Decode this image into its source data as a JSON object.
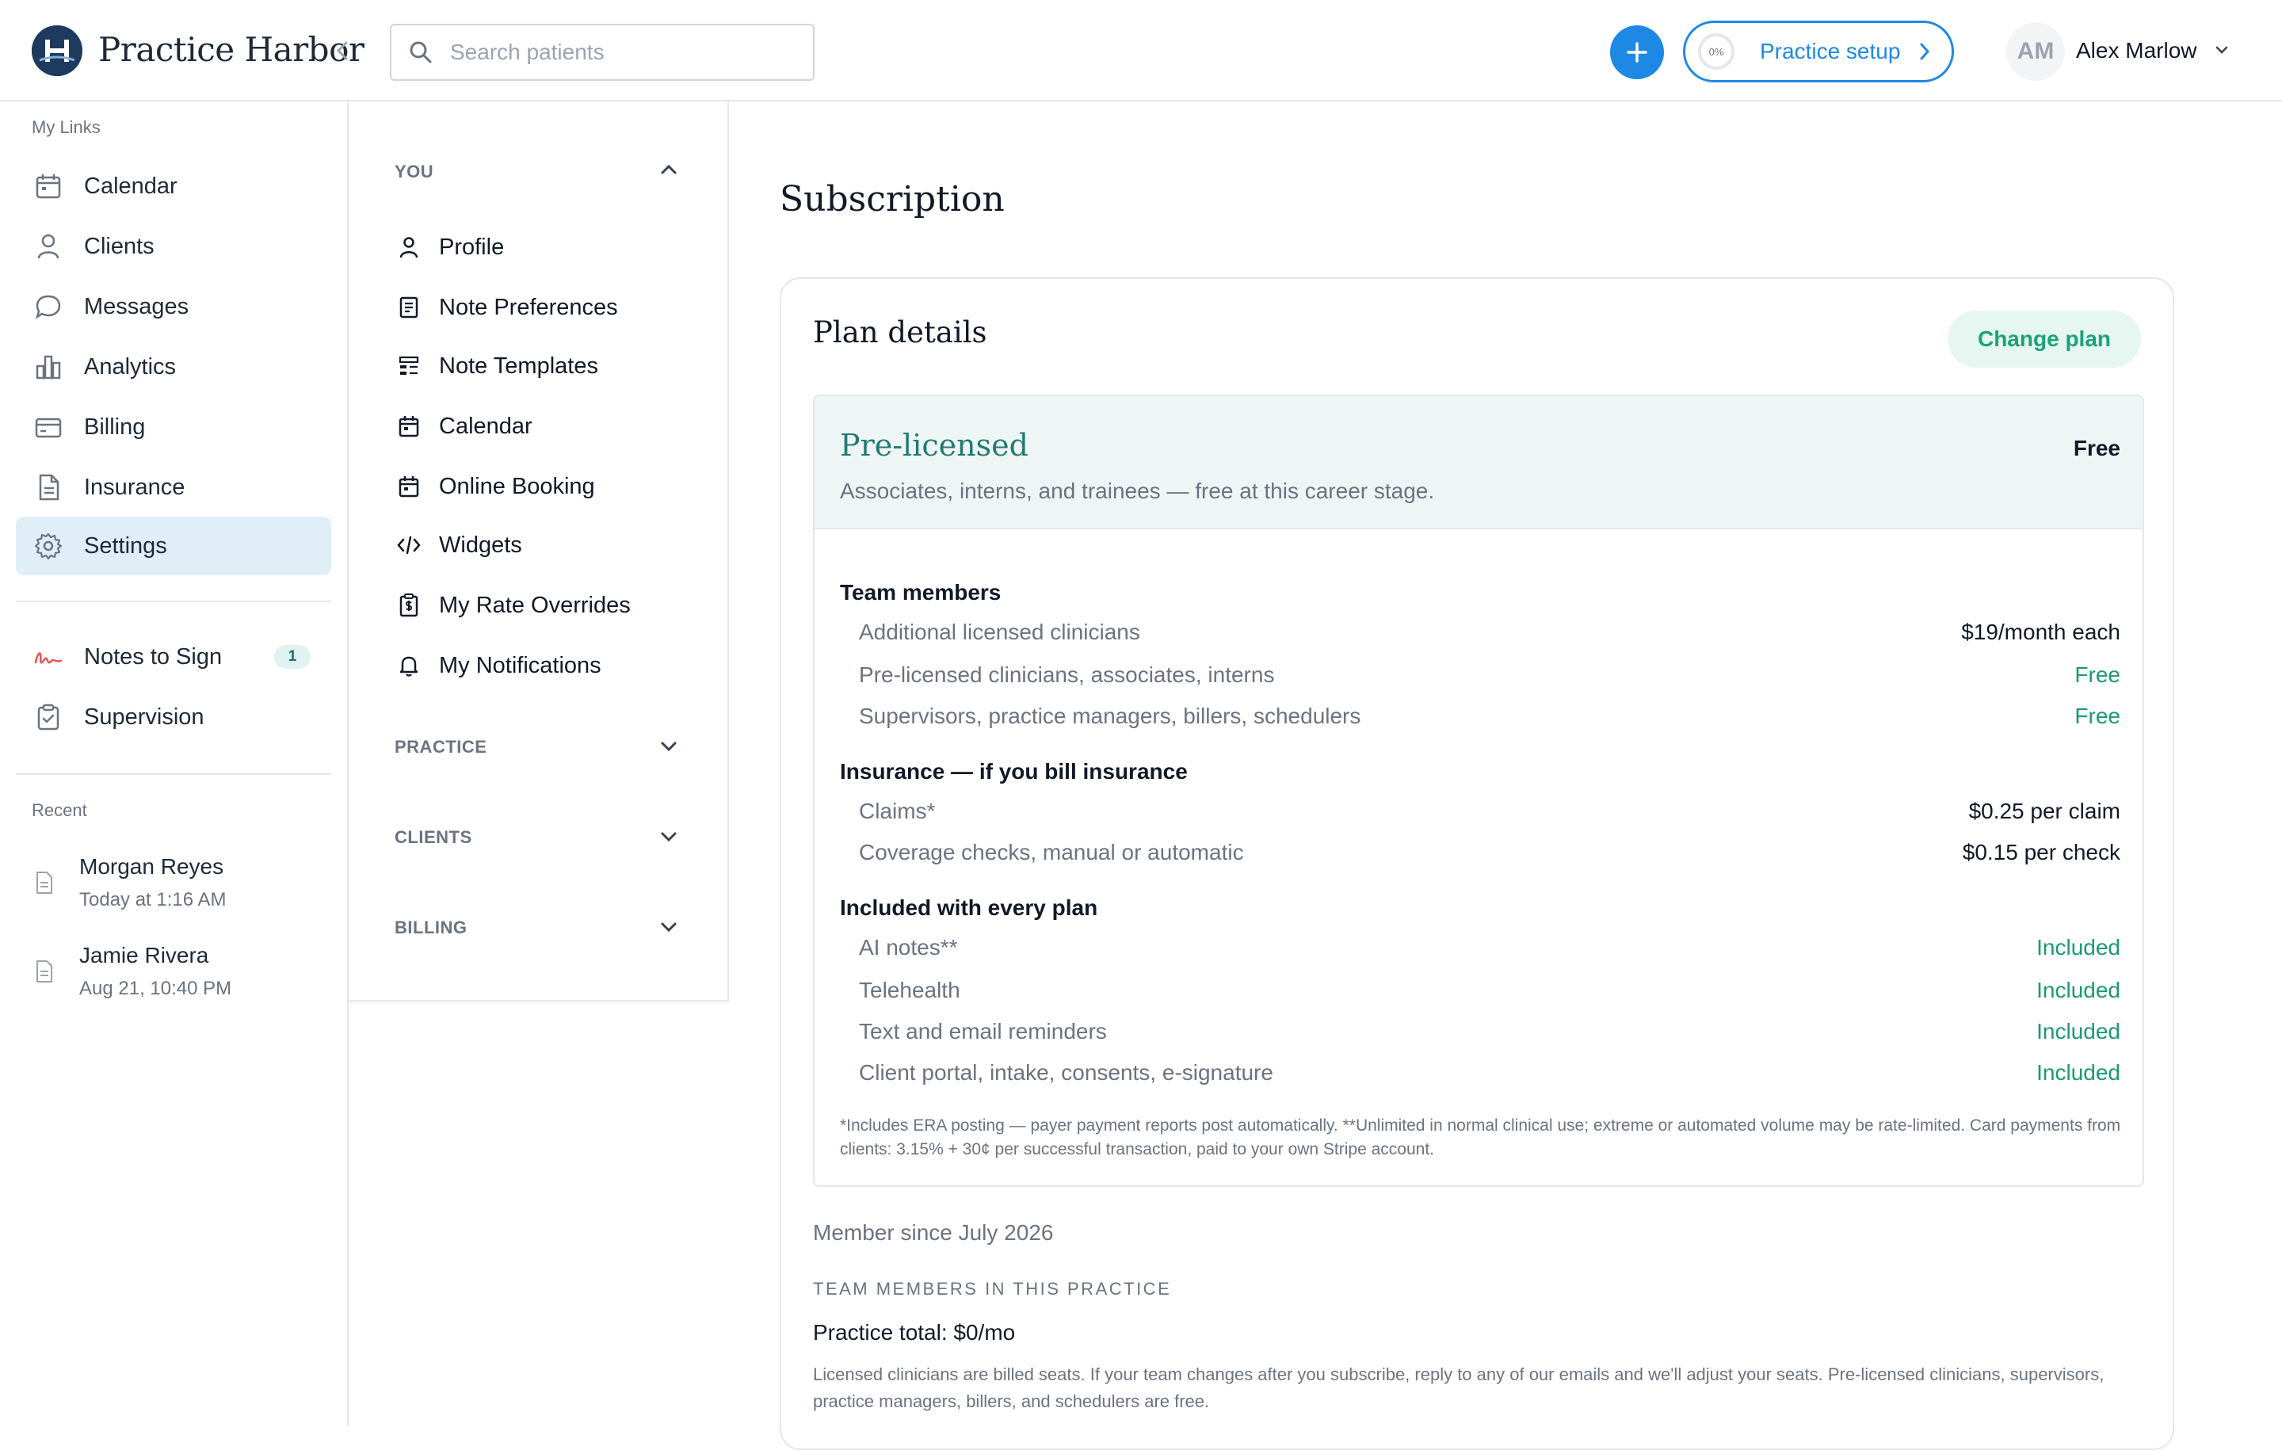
{
  "header": {
    "brand": "Practice Harbor",
    "logo_letter": "H",
    "search_placeholder": "Search patients",
    "setup_progress": "0%",
    "setup_label": "Practice setup",
    "user_initials": "AM",
    "user_name": "Alex Marlow"
  },
  "sidebar": {
    "my_links_label": "My Links",
    "items": [
      {
        "label": "Calendar",
        "icon": "calendar-icon"
      },
      {
        "label": "Clients",
        "icon": "person-icon"
      },
      {
        "label": "Messages",
        "icon": "chat-bubble-icon"
      },
      {
        "label": "Analytics",
        "icon": "bar-chart-icon"
      },
      {
        "label": "Billing",
        "icon": "card-icon"
      },
      {
        "label": "Insurance",
        "icon": "document-icon"
      },
      {
        "label": "Settings",
        "icon": "gear-icon",
        "active": true
      }
    ],
    "tasks": [
      {
        "label": "Notes to Sign",
        "icon": "signature-icon",
        "badge": "1"
      },
      {
        "label": "Supervision",
        "icon": "clipboard-check-icon"
      }
    ],
    "recent_label": "Recent",
    "recent": [
      {
        "name": "Morgan Reyes",
        "time": "Today at 1:16 AM"
      },
      {
        "name": "Jamie Rivera",
        "time": "Aug 21, 10:40 PM"
      }
    ]
  },
  "settings_nav": {
    "you_label": "YOU",
    "you_items": [
      {
        "label": "Profile",
        "icon": "person-icon"
      },
      {
        "label": "Note Preferences",
        "icon": "note-icon"
      },
      {
        "label": "Note Templates",
        "icon": "template-icon"
      },
      {
        "label": "Calendar",
        "icon": "calendar-icon"
      },
      {
        "label": "Online Booking",
        "icon": "calendar-icon"
      },
      {
        "label": "Widgets",
        "icon": "code-icon"
      },
      {
        "label": "My Rate Overrides",
        "icon": "dollar-clipboard-icon"
      },
      {
        "label": "My Notifications",
        "icon": "bell-icon"
      }
    ],
    "practice_label": "PRACTICE",
    "clients_label": "CLIENTS",
    "billing_label": "BILLING"
  },
  "main": {
    "title": "Subscription",
    "card_title": "Plan details",
    "change_plan": "Change plan",
    "plan_name": "Pre-licensed",
    "plan_desc": "Associates, interns, and trainees — free at this career stage.",
    "plan_price": "Free",
    "sections": [
      {
        "heading": "Team members",
        "rows": [
          {
            "label": "Additional licensed clinicians",
            "value": "$19/month each"
          },
          {
            "label": "Pre-licensed clinicians, associates, interns",
            "value": "Free"
          },
          {
            "label": "Supervisors, practice managers, billers, schedulers",
            "value": "Free"
          }
        ]
      },
      {
        "heading": "Insurance — if you bill insurance",
        "rows": [
          {
            "label": "Claims*",
            "value": "$0.25 per claim"
          },
          {
            "label": "Coverage checks, manual or automatic",
            "value": "$0.15 per check"
          }
        ]
      },
      {
        "heading": "Included with every plan",
        "rows": [
          {
            "label": "AI notes**",
            "value": "Included"
          },
          {
            "label": "Telehealth",
            "value": "Included"
          },
          {
            "label": "Text and email reminders",
            "value": "Included"
          },
          {
            "label": "Client portal, intake, consents, e-signature",
            "value": "Included"
          }
        ]
      }
    ],
    "footnote": "*Includes ERA posting — payer payment reports post automatically. **Unlimited in normal clinical use; extreme or automated volume may be rate-limited. Card payments from clients: 3.15% + 30¢ per successful transaction, paid to your own Stripe account.",
    "member_since": "Member since July 2026",
    "team_heading": "TEAM MEMBERS IN THIS PRACTICE",
    "practice_total": "Practice total: $0/mo",
    "seat_note": "Licensed clinicians are billed seats. If your team changes after you subscribe, reply to any of our emails and we'll adjust your seats. Pre-licensed clinicians, supervisors, practice managers, billers, and schedulers are free."
  },
  "colors": {
    "accent_blue": "#1e88e5",
    "teal": "#237a72",
    "green": "#1b9a72",
    "active_bg": "#e0eef8"
  }
}
